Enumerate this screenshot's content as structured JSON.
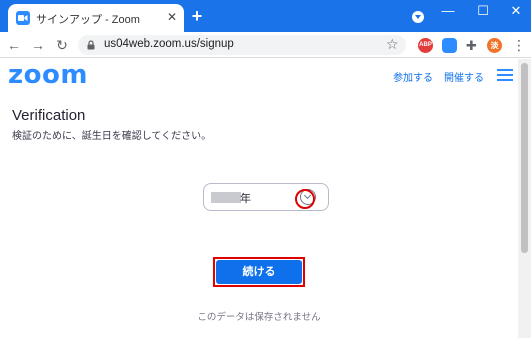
{
  "browser": {
    "tab_title": "サインアップ - Zoom",
    "tab_close": "✕",
    "new_tab": "+",
    "url": "us04web.zoom.us/signup",
    "window_min": "—",
    "window_max": "☐",
    "window_close": "✕",
    "extensions": [
      {
        "label": "ABP",
        "color": "#e23c3c"
      },
      {
        "label": "",
        "color": "#2d8cff"
      },
      {
        "label": "",
        "color": "#5f6368"
      },
      {
        "label": "淡",
        "color": "#f0732a"
      }
    ],
    "accent_color": "#1a73e8"
  },
  "zoom_header": {
    "logo": "zoom",
    "join_link": "参加する",
    "host_link": "開催する"
  },
  "main": {
    "title": "Verification",
    "subtitle": "検証のために、誕生日を確認してください。",
    "year_select": {
      "value_suffix": "年"
    },
    "continue_button": "続ける",
    "note": "このデータは保存されません"
  },
  "colors": {
    "zoom_blue": "#2d8cff",
    "button_blue": "#0e71eb",
    "highlight_red": "#e00000"
  }
}
